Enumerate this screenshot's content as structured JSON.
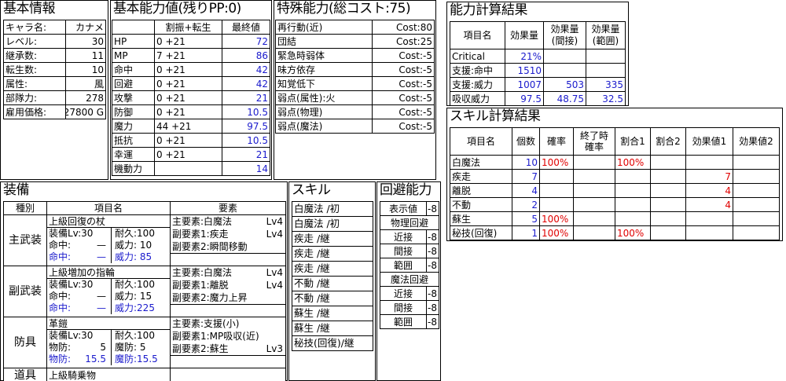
{
  "basic": {
    "title": "基本情報",
    "rows": [
      {
        "label": "キャラ名:",
        "value": "カナメ"
      },
      {
        "label": "レベル:",
        "value": "30"
      },
      {
        "label": "継承数:",
        "value": "11"
      },
      {
        "label": "転生数:",
        "value": "10"
      },
      {
        "label": "属性:",
        "value": "風"
      },
      {
        "label": "部隊力:",
        "value": "278"
      },
      {
        "label": "雇用価格:",
        "value": "27800 G"
      }
    ]
  },
  "ability": {
    "title": "基本能力値(残りPP:0)",
    "h_alloc": "割振+転生",
    "h_final": "最終値",
    "rows": [
      {
        "name": "HP",
        "alloc": "0 +21",
        "final": "72",
        "blue": true
      },
      {
        "name": "MP",
        "alloc": "7 +21",
        "final": "86",
        "blue": true
      },
      {
        "name": "命中",
        "alloc": "0 +21",
        "final": "42",
        "blue": true
      },
      {
        "name": "回避",
        "alloc": "0 +21",
        "final": "42",
        "blue": true
      },
      {
        "name": "攻撃",
        "alloc": "0 +21",
        "final": "21",
        "blue": true
      },
      {
        "name": "防御",
        "alloc": "0 +21",
        "final": "10.5",
        "blue": true
      },
      {
        "name": "魔力",
        "alloc": "44 +21",
        "final": "97.5",
        "blue": true
      },
      {
        "name": "抵抗",
        "alloc": "0 +21",
        "final": "10.5",
        "blue": true
      },
      {
        "name": "幸運",
        "alloc": "0 +21",
        "final": "21",
        "blue": true
      },
      {
        "name": "機動力",
        "alloc": "",
        "final": "14",
        "blue": true
      }
    ]
  },
  "special": {
    "title": "特殊能力(総コスト:75)",
    "rows": [
      {
        "name": "再行動(近)",
        "cost": "Cost:80"
      },
      {
        "name": "団結",
        "cost": "Cost:25"
      },
      {
        "name": "緊急時弱体",
        "cost": "Cost:-5"
      },
      {
        "name": "味方依存",
        "cost": "Cost:-5"
      },
      {
        "name": "知覚低下",
        "cost": "Cost:-5"
      },
      {
        "name": "弱点(属性):火",
        "cost": "Cost:-5"
      },
      {
        "name": "弱点(物理)",
        "cost": "Cost:-5"
      },
      {
        "name": "弱点(魔法)",
        "cost": "Cost:-5"
      }
    ]
  },
  "abilcalc": {
    "title": "能力計算結果",
    "headers": [
      "項目名",
      "効果量",
      "効果量\n(間接)",
      "効果量\n(範囲)"
    ],
    "rows": [
      [
        "Critical",
        "21%",
        "",
        ""
      ],
      [
        "支援:命中",
        "1510",
        "",
        ""
      ],
      [
        "支援:威力",
        "1007",
        "503",
        "335"
      ],
      [
        "吸収威力",
        "97.5",
        "48.75",
        "32.5"
      ]
    ]
  },
  "skillcalc": {
    "title": "スキル計算結果",
    "headers": [
      "項目名",
      "個数",
      "確率",
      "終了時\n確率",
      "割合1",
      "割合2",
      "効果値1",
      "効果値2"
    ],
    "rows": [
      [
        "白魔法",
        "10",
        "100%",
        "",
        "100%",
        "",
        "",
        ""
      ],
      [
        "疾走",
        "7",
        "",
        "",
        "",
        "",
        "7",
        ""
      ],
      [
        "離脱",
        "4",
        "",
        "",
        "",
        "",
        "4",
        ""
      ],
      [
        "不動",
        "2",
        "",
        "",
        "",
        "",
        "4",
        ""
      ],
      [
        "蘇生",
        "5",
        "100%",
        "",
        "",
        "",
        "",
        ""
      ],
      [
        "秘技(回復)",
        "1",
        "100%",
        "",
        "100%",
        "",
        "",
        ""
      ]
    ]
  },
  "equip": {
    "title": "装備",
    "h_type": "種別",
    "h_name": "項目名",
    "h_elem": "要素",
    "slots": [
      {
        "type": "主武装",
        "name": "上級回復の杖",
        "equip_lv": "装備Lv:30",
        "dur": "耐久:100",
        "l2a": "命中:",
        "l2b": "—",
        "l2c": "威力: 10",
        "l3a": "命中:",
        "l3b": "—",
        "l3c": "威力: 85",
        "e1": "主要素:白魔法",
        "e1lv": "Lv4",
        "e2": "副要素1:疾走",
        "e2lv": "Lv4",
        "e3": "副要素2:瞬間移動",
        "e3lv": ""
      },
      {
        "type": "副武装",
        "name": "上級増加の指輪",
        "equip_lv": "装備Lv:30",
        "dur": "耐久:100",
        "l2a": "命中:",
        "l2b": "—",
        "l2c": "威力: 15",
        "l3a": "命中:",
        "l3b": "—",
        "l3c": "威力:225",
        "e1": "主要素:白魔法",
        "e1lv": "Lv4",
        "e2": "副要素1:離脱",
        "e2lv": "Lv4",
        "e3": "副要素2:魔力上昇",
        "e3lv": ""
      },
      {
        "type": "防具",
        "name": "革鎧",
        "equip_lv": "装備Lv:30",
        "dur": "耐久:100",
        "l2a": "物防:",
        "l2b": "5",
        "l2c": "魔防:   5",
        "l3a": "物防:",
        "l3b": "15.5",
        "l3c": "魔防:15.5",
        "e1": "主要素:支援(小)",
        "e1lv": "",
        "e2": "副要素1:MP吸収(近)",
        "e2lv": "",
        "e3": "副要素2:蘇生",
        "e3lv": "Lv3"
      }
    ],
    "tool_type": "道具",
    "tool_name": "上級騎乗物"
  },
  "skills": {
    "title": "スキル",
    "items": [
      "白魔法 /初",
      "白魔法 /初",
      "疾走 /継",
      "疾走 /継",
      "疾走 /継",
      "不動 /継",
      "不動 /継",
      "蘇生 /継",
      "蘇生 /継",
      "秘技(回復)/継"
    ]
  },
  "evasion": {
    "title": "回避能力",
    "h_label": "表示値",
    "h_val": "-8",
    "phys": "物理回避",
    "magic": "魔法回避",
    "rows_phys": [
      {
        "l": "近接",
        "v": "-8"
      },
      {
        "l": "間接",
        "v": "-8"
      },
      {
        "l": "範囲",
        "v": "-8"
      }
    ],
    "rows_magic": [
      {
        "l": "近接",
        "v": "-8"
      },
      {
        "l": "間接",
        "v": "-8"
      },
      {
        "l": "範囲",
        "v": "-8"
      }
    ]
  }
}
